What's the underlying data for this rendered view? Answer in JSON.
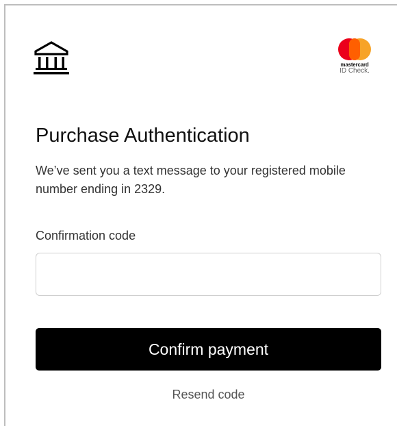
{
  "header": {
    "bank_logo_icon": "bank-building-icon",
    "brand_logo": {
      "name": "mastercard",
      "subtitle": "ID Check.",
      "colors": {
        "red": "#eb001b",
        "yellow": "#f79e1b",
        "overlap": "#ff5f00"
      }
    }
  },
  "main": {
    "title": "Purchase Authentication",
    "message": "We’ve sent you a text message to your registered mobile number ending in 2329.",
    "confirmation_label": "Confirmation code",
    "confirmation_value": "",
    "confirm_button": "Confirm payment",
    "resend_link": "Resend code"
  },
  "colors": {
    "button_bg": "#000000",
    "button_text": "#ffffff",
    "text_primary": "#111111",
    "text_secondary": "#555555"
  }
}
